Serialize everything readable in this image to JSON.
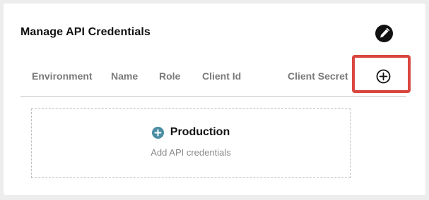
{
  "panel": {
    "title": "Manage API Credentials",
    "edit_icon": "pen-icon"
  },
  "table": {
    "columns": [
      "Environment",
      "Name",
      "Role",
      "Client Id",
      "Client Secret"
    ],
    "add_icon": "plus-circle-icon"
  },
  "environments": [
    {
      "name": "Production",
      "hint": "Add API credentials",
      "icon": "plus-circle-filled-icon"
    }
  ],
  "colors": {
    "highlight": "#d9473f",
    "accent": "#4b8ea3",
    "column_header": "#7a7a7a"
  }
}
